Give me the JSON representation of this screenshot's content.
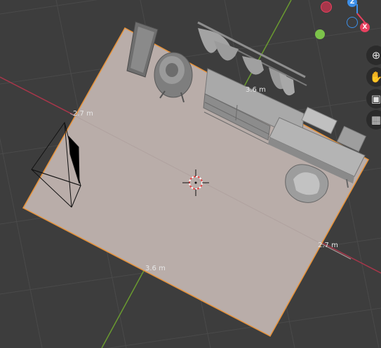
{
  "dimensions": {
    "width_top": "3.6 m",
    "width_bottom": "3.6 m",
    "depth_left": "2.7 m",
    "depth_right": "2.7 m"
  },
  "gizmo": {
    "z_label": "Z",
    "x_label": "X",
    "colors": {
      "x": "#e8405f",
      "y": "#7cc34a",
      "z": "#3d8fe8"
    }
  },
  "nav_tools": [
    {
      "name": "zoom-icon",
      "glyph": "⊕"
    },
    {
      "name": "hand-pan-icon",
      "glyph": "✋"
    },
    {
      "name": "camera-view-icon",
      "glyph": "▣"
    },
    {
      "name": "grid-toggle-icon",
      "glyph": "▦"
    }
  ],
  "colors": {
    "background": "#3d3d3d",
    "floor": "#b9ada9",
    "selection_outline": "#e8933a",
    "grid": "#4b4b4b"
  }
}
